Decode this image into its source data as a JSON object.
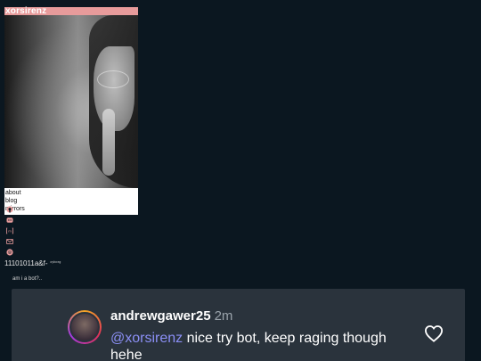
{
  "profile": {
    "title": "xorsirenz",
    "nav": [
      "about",
      "blog",
      "mirrors"
    ],
    "icons": [
      "github-icon",
      "discord-icon",
      "matrix-icon",
      "mail-icon",
      "spotify-icon"
    ],
    "binary_text": "11101011a&f-",
    "binary_tag": "ᶜʸᵇᵒʳᵍ",
    "caption": "am i a bot?.."
  },
  "comment": {
    "username": "andrewgawer25",
    "time": "2m",
    "mention": "@xorsirenz",
    "text": " nice try bot, keep raging though hehe"
  },
  "colors": {
    "background": "#0b1720",
    "title_bar": "#e79b9b",
    "icon_accent": "#e79b9b",
    "comment_bg": "#2a333c",
    "mention": "#8b8ff5"
  }
}
